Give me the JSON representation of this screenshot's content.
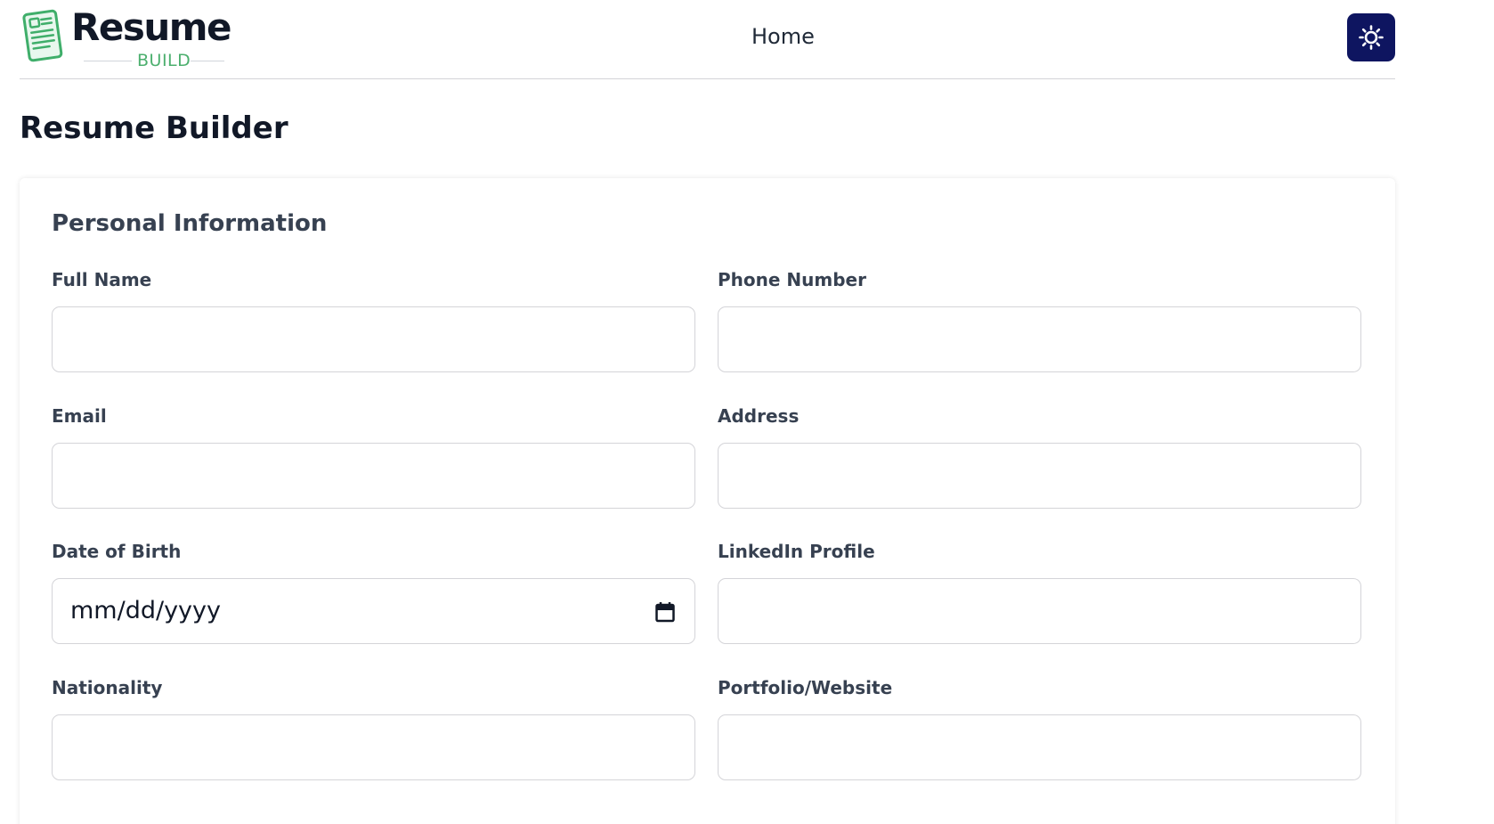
{
  "header": {
    "logo": {
      "title": "Resume",
      "subtitle": "BUILD",
      "icon": "document-icon"
    },
    "nav": {
      "home_label": "Home"
    },
    "theme_toggle": {
      "icon": "sun-icon"
    }
  },
  "page": {
    "title": "Resume Builder"
  },
  "form": {
    "section_title": "Personal Information",
    "fields": {
      "full_name": {
        "label": "Full Name",
        "value": ""
      },
      "phone_number": {
        "label": "Phone Number",
        "value": ""
      },
      "email": {
        "label": "Email",
        "value": ""
      },
      "address": {
        "label": "Address",
        "value": ""
      },
      "date_of_birth": {
        "label": "Date of Birth",
        "placeholder": "mm/dd/yyyy",
        "icon": "calendar-icon"
      },
      "linkedin_profile": {
        "label": "LinkedIn Profile",
        "value": ""
      },
      "nationality": {
        "label": "Nationality",
        "value": ""
      },
      "portfolio_website": {
        "label": "Portfolio/Website",
        "value": ""
      }
    }
  },
  "colors": {
    "brand_green": "#4caf6e",
    "toggle_bg": "#0e1560",
    "border": "#d4d4d8"
  }
}
